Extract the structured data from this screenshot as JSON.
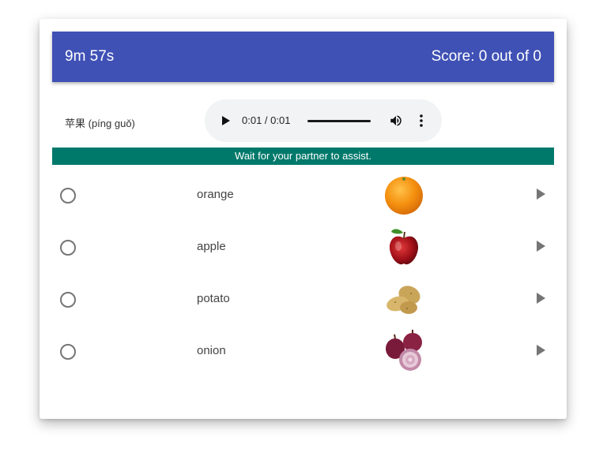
{
  "header": {
    "timer": "9m 57s",
    "score": "Score: 0 out of 0",
    "color": "#3f51b5"
  },
  "prompt": {
    "text": "苹果 (píng guǒ)"
  },
  "audio": {
    "time": "0:01 / 0:01",
    "progress_fraction": 1.0
  },
  "banner": {
    "text": "Wait for your partner to assist.",
    "color": "#00796b"
  },
  "options": [
    {
      "label": "orange",
      "image_icon": "orange-image",
      "selected": false
    },
    {
      "label": "apple",
      "image_icon": "apple-image",
      "selected": false
    },
    {
      "label": "potato",
      "image_icon": "potato-image",
      "selected": false
    },
    {
      "label": "onion",
      "image_icon": "onion-image",
      "selected": false
    }
  ]
}
